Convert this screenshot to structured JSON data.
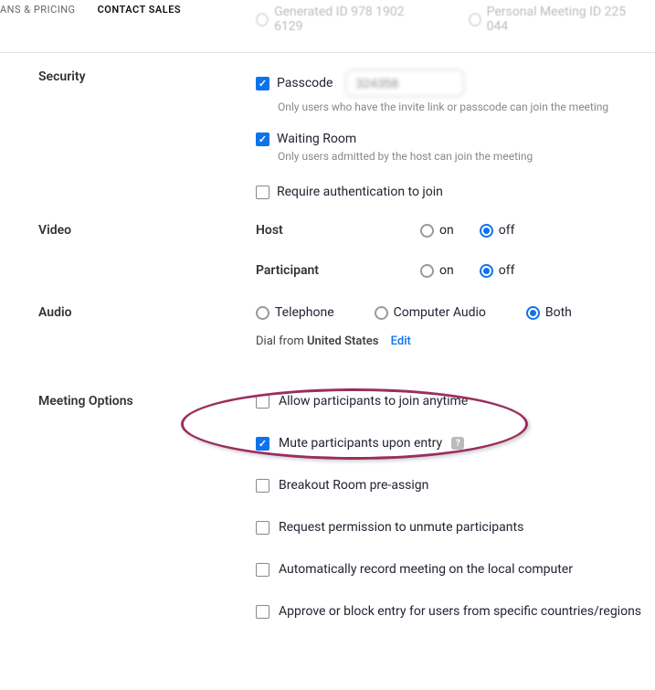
{
  "nav": {
    "plans": "ANS & PRICING",
    "contact": "CONTACT SALES"
  },
  "meetingId": {
    "generated_label": "Generated ID 978 1902 6129",
    "personal_label": "Personal Meeting ID 225 044"
  },
  "security": {
    "title": "Security",
    "passcode_label": "Passcode",
    "passcode_value": "324358",
    "passcode_sub": "Only users who have the invite link or passcode can join the meeting",
    "waiting_label": "Waiting Room",
    "waiting_sub": "Only users admitted by the host can join the meeting",
    "auth_label": "Require authentication to join"
  },
  "video": {
    "title": "Video",
    "host_label": "Host",
    "participant_label": "Participant",
    "on": "on",
    "off": "off"
  },
  "audio": {
    "title": "Audio",
    "telephone": "Telephone",
    "computer": "Computer Audio",
    "both": "Both",
    "dial_prefix": "Dial from ",
    "dial_country": "United States",
    "edit": "Edit"
  },
  "options": {
    "title": "Meeting Options",
    "allow_anytime": "Allow participants to join anytime",
    "mute_entry": "Mute participants upon entry",
    "breakout": "Breakout Room pre-assign",
    "request_unmute": "Request permission to unmute participants",
    "auto_record": "Automatically record meeting on the local computer",
    "approve_block": "Approve or block entry for users from specific countries/regions"
  }
}
